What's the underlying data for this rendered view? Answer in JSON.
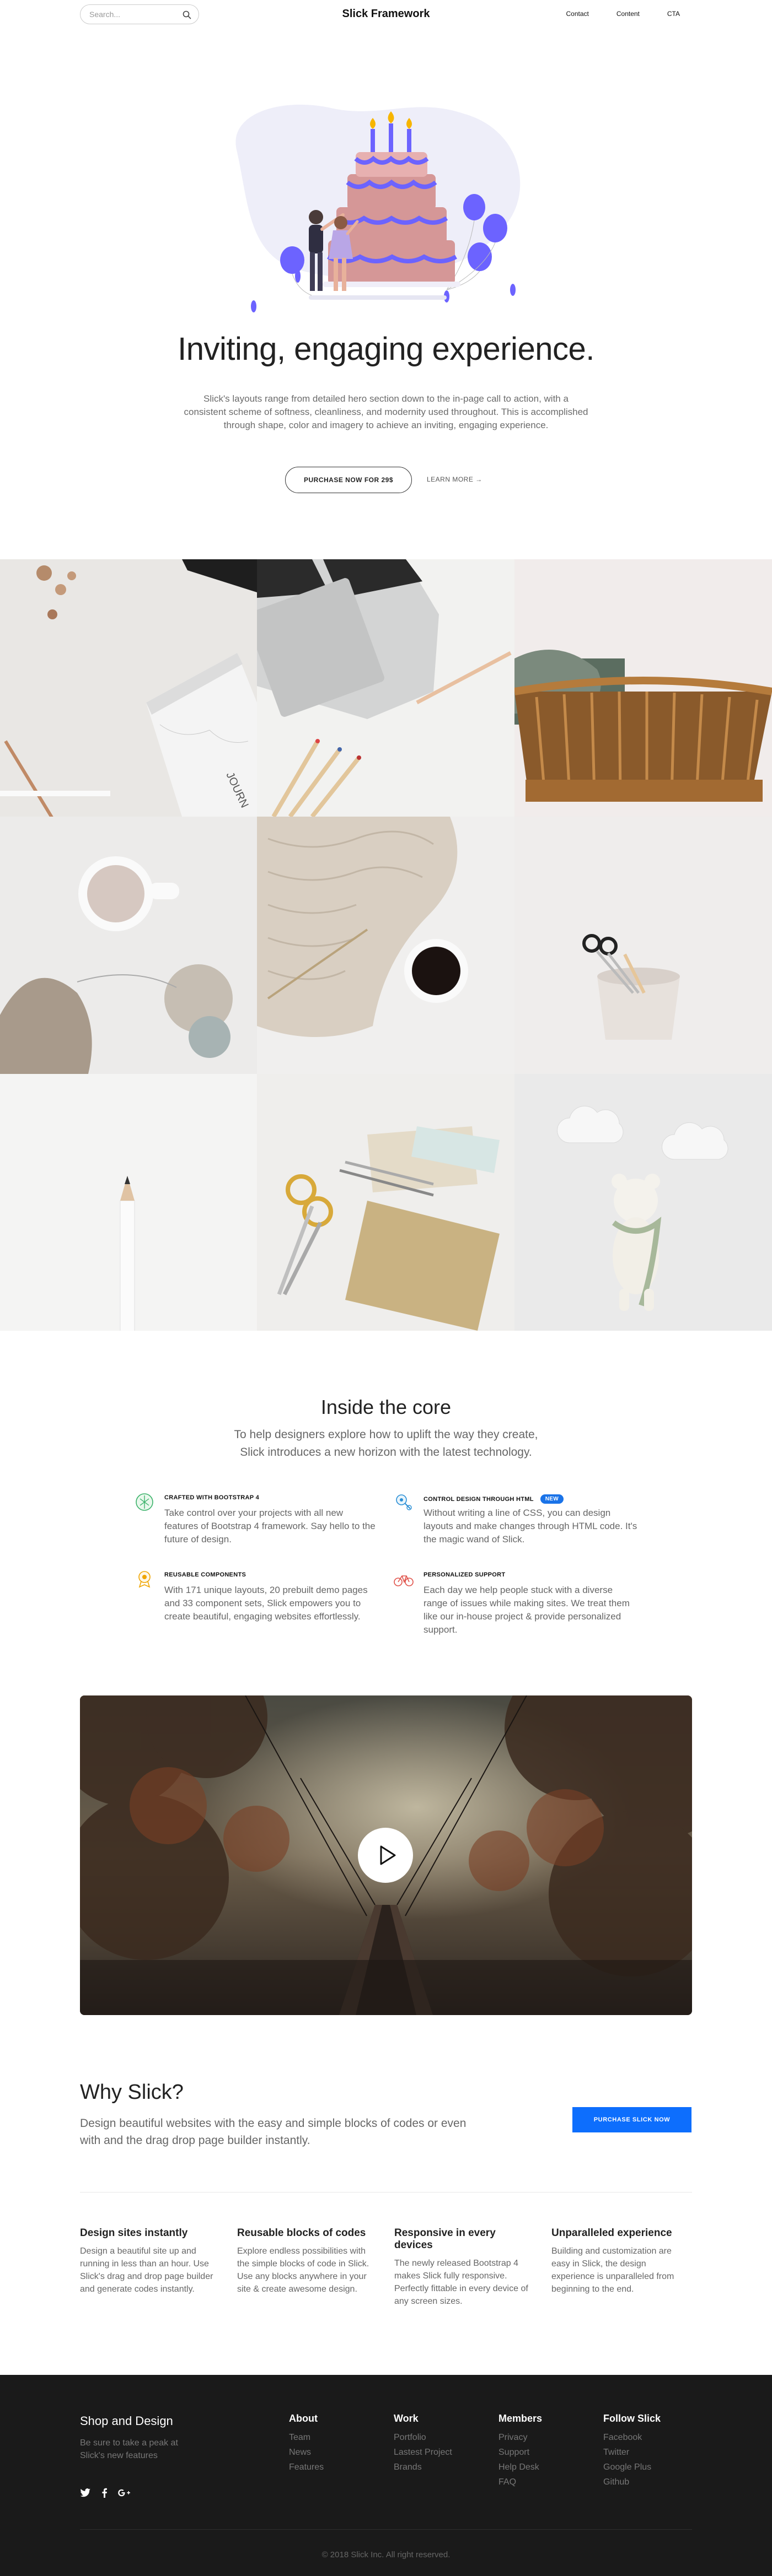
{
  "nav": {
    "search_placeholder": "Search...",
    "brand": "Slick Framework",
    "links": [
      "Contact",
      "Content",
      "CTA"
    ]
  },
  "hero": {
    "title": "Inviting, engaging experience.",
    "text": "Slick's layouts range from detailed hero section down to the in-page call to action, with a consistent scheme of softness, cleanliness, and modernity used throughout. This is accomplished through shape, color and imagery to achieve an inviting, engaging experience.",
    "primary_button": "PURCHASE NOW FOR 29$",
    "secondary_link": "LEARN MORE →"
  },
  "gallery": {
    "images": [
      "workspace-journal",
      "laptop-pencils",
      "wicker-basket",
      "coffee-knitting",
      "knit-blanket-coffee",
      "scissors-pot",
      "pencil",
      "scissors-notebook",
      "toys-cloud-bear"
    ]
  },
  "core": {
    "title": "Inside the core",
    "subtitle": "To help designers explore how to uplift the way they create, Slick introduces a new horizon with the latest technology.",
    "features": [
      {
        "icon": "bootstrap-icon",
        "title": "CRAFTED WITH BOOTSTRAP 4",
        "badge": "",
        "text": "Take control over your projects with all new features of Bootstrap 4 framework. Say hello to the future of design."
      },
      {
        "icon": "html-icon",
        "title": "CONTROL DESIGN THROUGH HTML",
        "badge": "NEW",
        "text": "Without writing a line of CSS, you can design layouts and make changes through HTML code. It's the magic wand of Slick."
      },
      {
        "icon": "components-icon",
        "title": "REUSABLE COMPONENTS",
        "badge": "",
        "text": "With 171 unique layouts, 20 prebuilt demo pages and 33 component sets, Slick empowers you to create beautiful, engaging websites effortlessly."
      },
      {
        "icon": "support-icon",
        "title": "PERSONALIZED SUPPORT",
        "badge": "",
        "text": "Each day we help people stuck with a diverse range of issues while making sites. We treat them like our in-house project & provide personalized support."
      }
    ]
  },
  "why": {
    "title": "Why Slick?",
    "text": "Design beautiful websites with the easy and simple blocks of codes or even with and the drag drop page builder instantly.",
    "button": "PURCHASE SLICK NOW",
    "columns": [
      {
        "title": "Design sites instantly",
        "text": "Design a beautiful site up and running in less than an hour. Use Slick's drag and drop page builder and generate codes instantly."
      },
      {
        "title": "Reusable blocks of codes",
        "text": "Explore endless possibilities with the simple blocks of code in Slick. Use any blocks anywhere in your site & create awesome design."
      },
      {
        "title": "Responsive in every devices",
        "text": "The newly released Bootstrap 4 makes Slick fully responsive. Perfectly fittable in every device of any screen sizes."
      },
      {
        "title": "Unparalleled experience",
        "text": "Building and customization are easy in Slick, the design experience is unparalleled from beginning to the end."
      }
    ]
  },
  "footer": {
    "brand": "Shop and Design",
    "tagline": "Be sure to take a peak at Slick's new features",
    "social": [
      "twitter-icon",
      "facebook-icon",
      "google-plus-icon"
    ],
    "columns": [
      {
        "title": "About",
        "items": [
          "Team",
          "News",
          "Features"
        ]
      },
      {
        "title": "Work",
        "items": [
          "Portfolio",
          "Lastest Project",
          "Brands"
        ]
      },
      {
        "title": "Members",
        "items": [
          "Privacy",
          "Support",
          "Help Desk",
          "FAQ"
        ]
      },
      {
        "title": "Follow Slick",
        "items": [
          "Facebook",
          "Twitter",
          "Google Plus",
          "Github"
        ]
      }
    ],
    "copyright": "© 2018 Slick Inc. All right reserved."
  },
  "colors": {
    "accent": "#0d6efd",
    "illustration_purple": "#6c63ff",
    "footer_bg": "#1a1a1a"
  }
}
